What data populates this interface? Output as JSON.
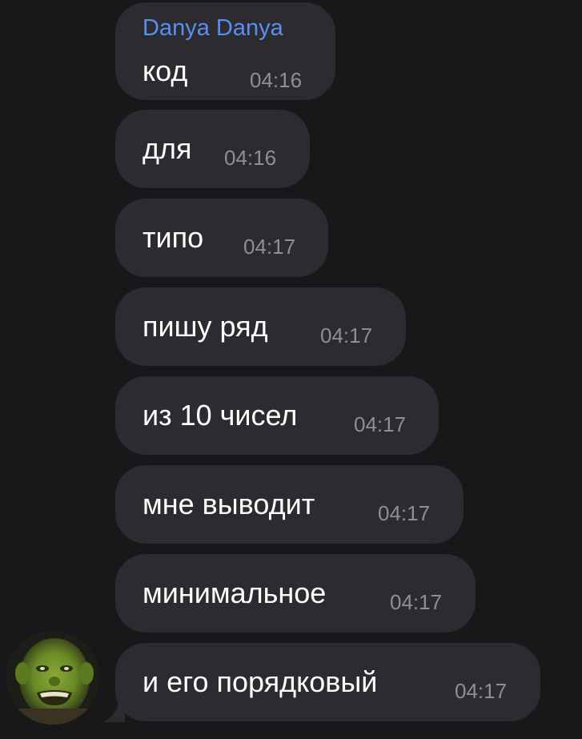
{
  "chat": {
    "sender_name": "Danya Danya",
    "messages": [
      {
        "text": "код",
        "time": "04:16"
      },
      {
        "text": "для",
        "time": "04:16"
      },
      {
        "text": "типо",
        "time": "04:17"
      },
      {
        "text": "пишу ряд",
        "time": "04:17"
      },
      {
        "text": "из 10 чисел",
        "time": "04:17"
      },
      {
        "text": "мне выводит",
        "time": "04:17"
      },
      {
        "text": "минимальное",
        "time": "04:17"
      },
      {
        "text": "и его порядковый",
        "time": "04:17"
      }
    ]
  },
  "colors": {
    "background": "#18181b",
    "bubble": "#2b2b30",
    "sender_name": "#5a8ef0",
    "message_text": "#ffffff",
    "timestamp": "#8e8e93"
  },
  "icons": {
    "avatar": "avatar-image"
  }
}
